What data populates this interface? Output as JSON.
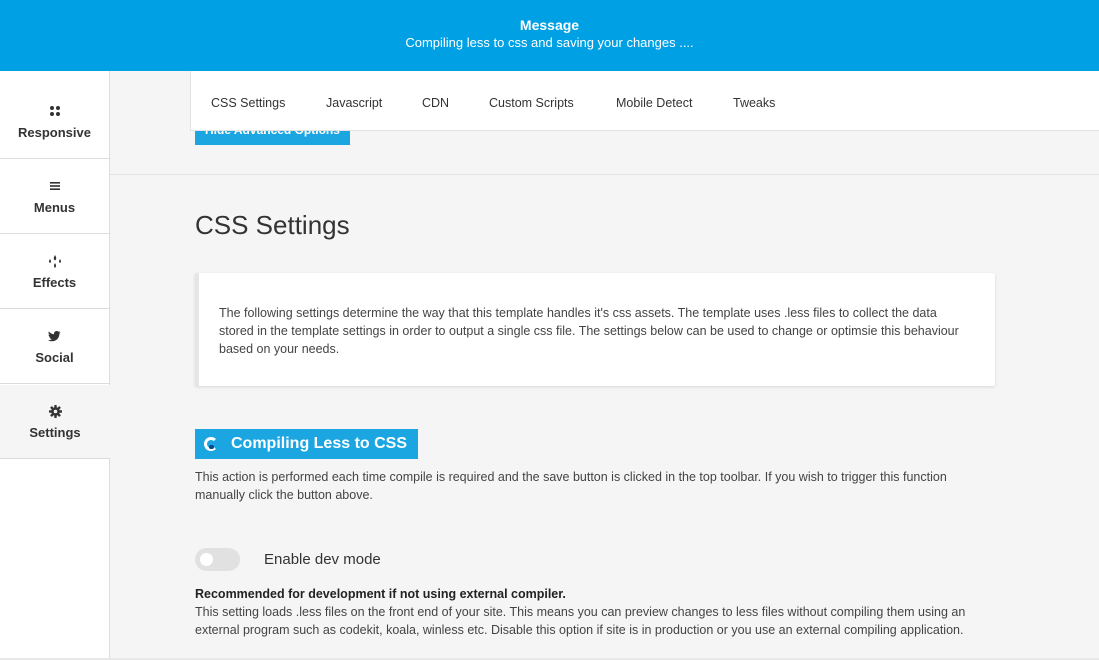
{
  "notification": {
    "title": "Message",
    "message": "Compiling less to css and saving your changes ...."
  },
  "sidebar": {
    "items": [
      {
        "label": "Responsive",
        "icon": "grid-icon"
      },
      {
        "label": "Menus",
        "icon": "menu-icon"
      },
      {
        "label": "Effects",
        "icon": "drops-icon"
      },
      {
        "label": "Social",
        "icon": "twitter-icon"
      },
      {
        "label": "Settings",
        "icon": "gear-icon",
        "active": true
      }
    ]
  },
  "tabs": [
    "CSS Settings",
    "Javascript",
    "CDN",
    "Custom Scripts",
    "Mobile Detect",
    "Tweaks"
  ],
  "partial_button": "Hide Advanced Options",
  "section": {
    "title": "CSS Settings",
    "info": "The following settings determine the way that this template handles it's css assets. The template uses .less files to collect the data stored in the template settings in order to output a single css file. The settings below can be used to change or optimsie this behaviour based on your needs."
  },
  "compile": {
    "button_label": "Compiling Less to CSS",
    "description": "This action is performed each time compile is required and the save button is clicked in the top toolbar. If you wish to trigger this function manually click the button above."
  },
  "dev_mode": {
    "label": "Enable dev mode",
    "enabled": false,
    "recommendation_title": "Recommended for development if not using external compiler.",
    "recommendation_text": "This setting loads .less files on the front end of your site. This means you can preview changes to less files without compiling them using an external program such as codekit, koala, winless etc. Disable this option if site is in production or you use an external compiling application."
  },
  "colors": {
    "accent": "#00a0e4",
    "button": "#1ba6e2"
  }
}
